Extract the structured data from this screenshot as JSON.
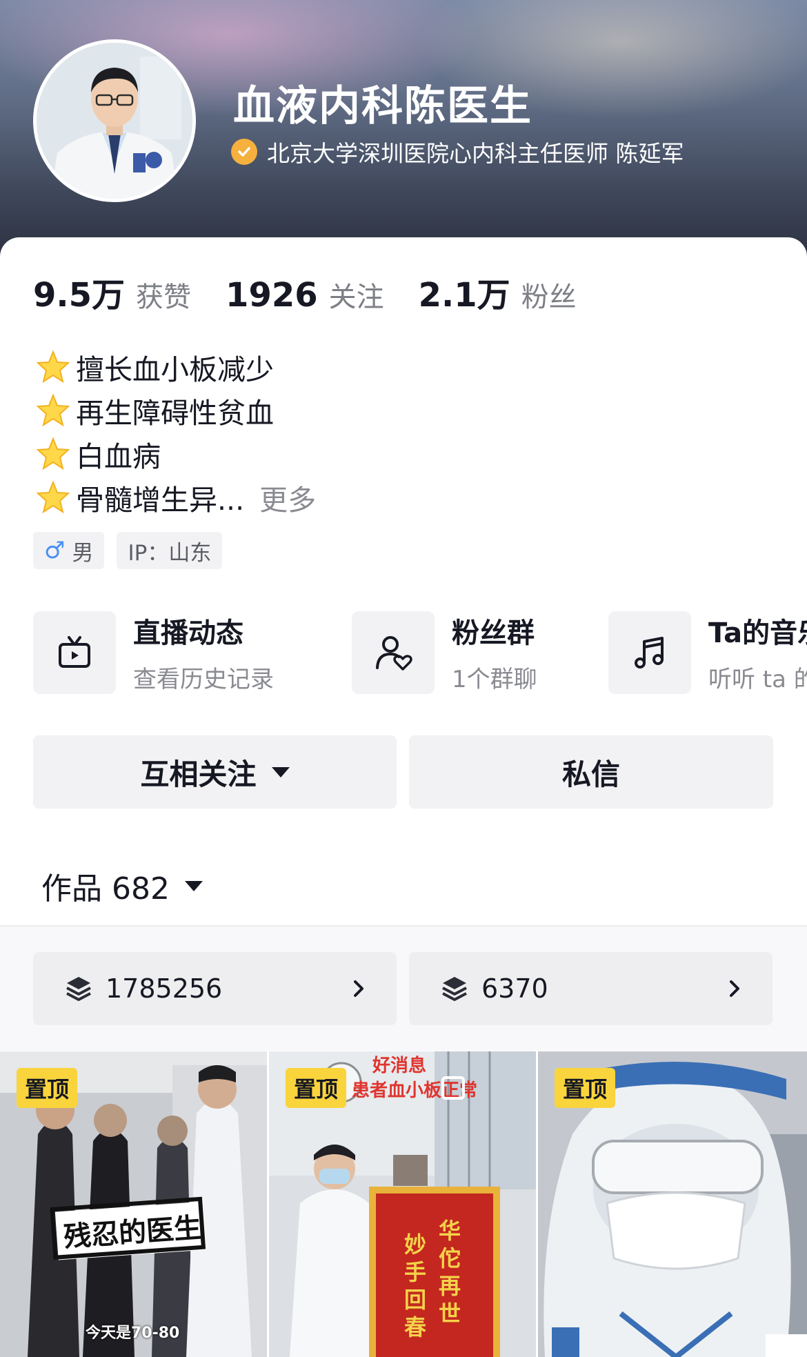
{
  "profile": {
    "name": "血液内科陈医生",
    "verification": "北京大学深圳医院心内科主任医师 陈延军"
  },
  "stats": [
    {
      "value": "9.5万",
      "label": "获赞"
    },
    {
      "value": "1926",
      "label": "关注"
    },
    {
      "value": "2.1万",
      "label": "粉丝"
    }
  ],
  "bio": {
    "lines": [
      "擅长血小板减少",
      "再生障碍性贫血",
      "白血病",
      "骨髓增生异..."
    ],
    "more": "更多"
  },
  "tags": {
    "gender": "男",
    "ip": "IP：山东"
  },
  "features": [
    {
      "title": "直播动态",
      "subtitle": "查看历史记录",
      "icon": "tv-icon"
    },
    {
      "title": "粉丝群",
      "subtitle": "1个群聊",
      "icon": "fan-group-icon"
    },
    {
      "title": "Ta的音乐",
      "subtitle": "听听 ta 的",
      "icon": "music-note-icon"
    }
  ],
  "actions": {
    "follow": "互相关注",
    "message": "私信"
  },
  "works": {
    "label": "作品 682"
  },
  "collections": [
    {
      "count": "1785256"
    },
    {
      "count": "6370"
    }
  ],
  "videos": [
    {
      "badge": "置顶",
      "overlay_title": "残忍的医生",
      "overlay_caption": "今天是70-80"
    },
    {
      "badge": "置顶",
      "banner_top": "好消息",
      "banner_sub": "患者血小板正常",
      "pennant_left": "妙手回春",
      "pennant_right": "华佗再世"
    },
    {
      "badge": "置顶"
    }
  ],
  "colors": {
    "accent_badge": "#f9d43c",
    "verify": "#f5b03d",
    "gender_blue": "#4a8ff5",
    "pennant_red": "#c4271f"
  }
}
